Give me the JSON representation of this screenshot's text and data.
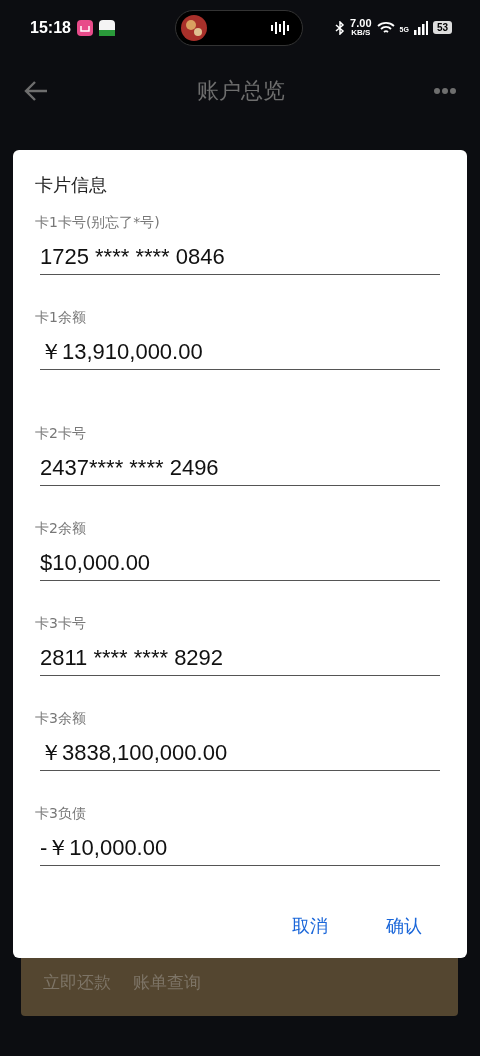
{
  "status_bar": {
    "time": "15:18",
    "net_speed": "7.00",
    "net_unit": "KB/S",
    "network": "5G",
    "battery": "53"
  },
  "header": {
    "title": "账户总览"
  },
  "dialog": {
    "title": "卡片信息",
    "fields": [
      {
        "label": "卡1卡号(别忘了*号)",
        "value": "1725 **** **** 0846"
      },
      {
        "label": "卡1余额",
        "value": "￥13,910,000.00"
      },
      {
        "label": "卡2卡号",
        "value": "2437**** **** 2496"
      },
      {
        "label": "卡2余额",
        "value": "$10,000.00"
      },
      {
        "label": "卡3卡号",
        "value": "2811 **** **** 8292"
      },
      {
        "label": "卡3余额",
        "value": "￥3838,100,000.00"
      },
      {
        "label": "卡3负债",
        "value": "-￥10,000.00"
      }
    ],
    "buttons": [
      "取消",
      "确认"
    ]
  },
  "bottom_actions": [
    "立即还款",
    "账单查询"
  ]
}
